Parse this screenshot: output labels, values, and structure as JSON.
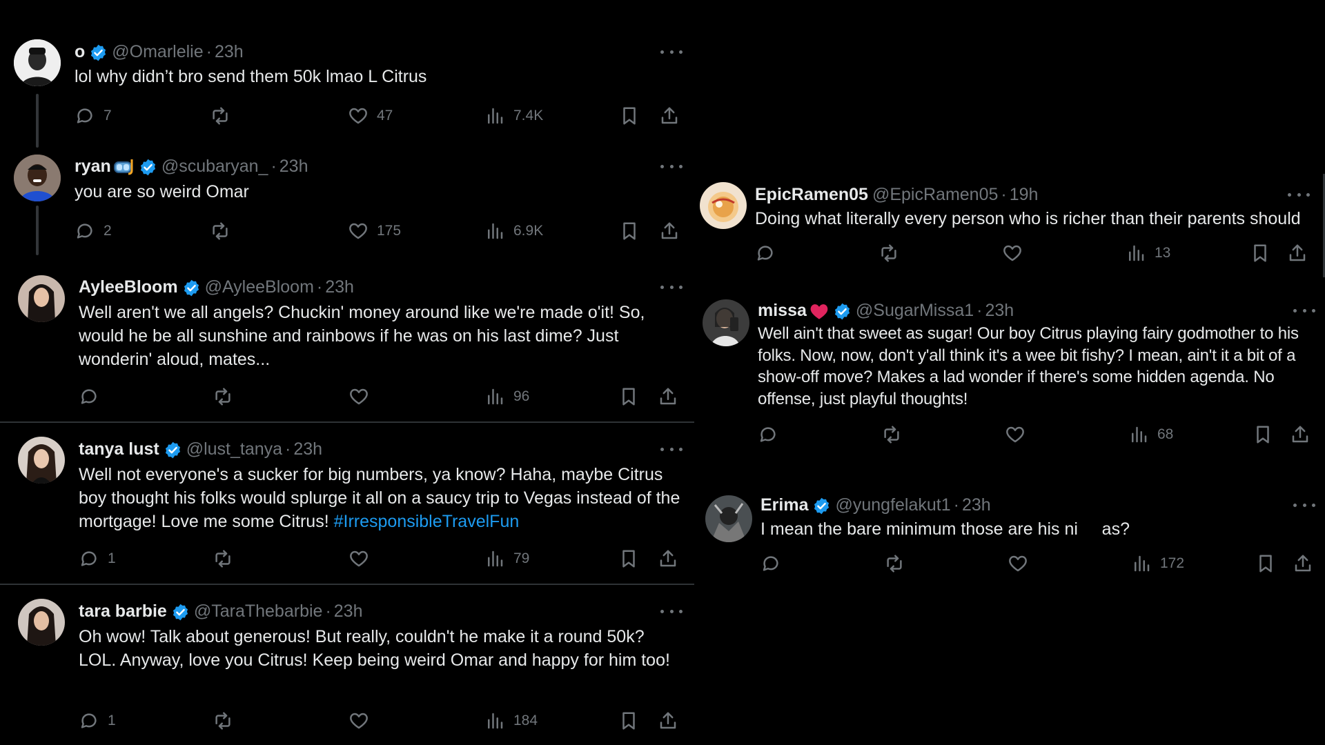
{
  "colors": {
    "background": "#000000",
    "text": "#e7e9ea",
    "muted": "#71767b",
    "accent": "#1d9bf0",
    "verified": "#1d9bf0"
  },
  "left_tweets": [
    {
      "name": "o",
      "handle": "@Omarlelie",
      "sep": "·",
      "time": "23h",
      "text": "lol why didn’t bro send them 50k lmao L Citrus",
      "replies": "7",
      "reposts": "",
      "likes": "47",
      "views": "7.4K"
    },
    {
      "name": "ryan",
      "name_emoji": "diving-mask-icon",
      "handle": "@scubaryan_",
      "sep": "·",
      "time": "23h",
      "text": "you are so weird Omar",
      "replies": "2",
      "reposts": "",
      "likes": "175",
      "views": "6.9K"
    },
    {
      "name": "AyleeBloom",
      "handle": "@AyleeBloom",
      "sep": "·",
      "time": "23h",
      "text": "Well aren't we all angels? Chuckin' money around like we're made o'it! So, would he be all sunshine and rainbows if he was on his last dime? Just wonderin' aloud, mates...",
      "replies": "",
      "reposts": "",
      "likes": "",
      "views": "96"
    },
    {
      "name": "tanya lust",
      "handle": "@lust_tanya",
      "sep": "·",
      "time": "23h",
      "text": "Well not everyone's a sucker for big numbers, ya know? Haha, maybe Citrus boy thought his folks would splurge it all on a saucy trip to Vegas instead of the mortgage! Love me some Citrus!",
      "hashtag": "#IrresponsibleTravelFun",
      "replies": "1",
      "reposts": "",
      "likes": "",
      "views": "79"
    },
    {
      "name": "tara barbie",
      "handle": "@TaraThebarbie",
      "sep": "·",
      "time": "23h",
      "text": "Oh wow! Talk about generous! But really, couldn't he make it a round 50k? LOL. Anyway, love you Citrus! Keep being weird Omar and happy for him too!",
      "replies": "1",
      "reposts": "",
      "likes": "",
      "views": "184"
    }
  ],
  "right_tweets": [
    {
      "name": "EpicRamen05",
      "handle": "@EpicRamen05",
      "sep": "·",
      "time": "19h",
      "text": "Doing what literally every person who is richer than their parents should",
      "replies": "",
      "reposts": "",
      "likes": "",
      "views": "13"
    },
    {
      "name": "missa",
      "name_emoji": "red-heart-icon",
      "handle": "@SugarMissa1",
      "sep": "·",
      "time": "23h",
      "text": "Well ain't that sweet as sugar! Our boy Citrus playing fairy godmother to his folks. Now, now, don't y'all think it's a wee bit fishy? I mean, ain't it a bit of a show-off move? Makes a lad wonder if there's some hidden agenda. No offense, just playful thoughts!",
      "replies": "",
      "reposts": "",
      "likes": "",
      "views": "68"
    },
    {
      "name": "Erima",
      "handle": "@yungfelakut1",
      "sep": "·",
      "time": "23h",
      "text": "I mean the bare minimum those are his ni     as?",
      "replies": "",
      "reposts": "",
      "likes": "",
      "views": "172"
    }
  ]
}
